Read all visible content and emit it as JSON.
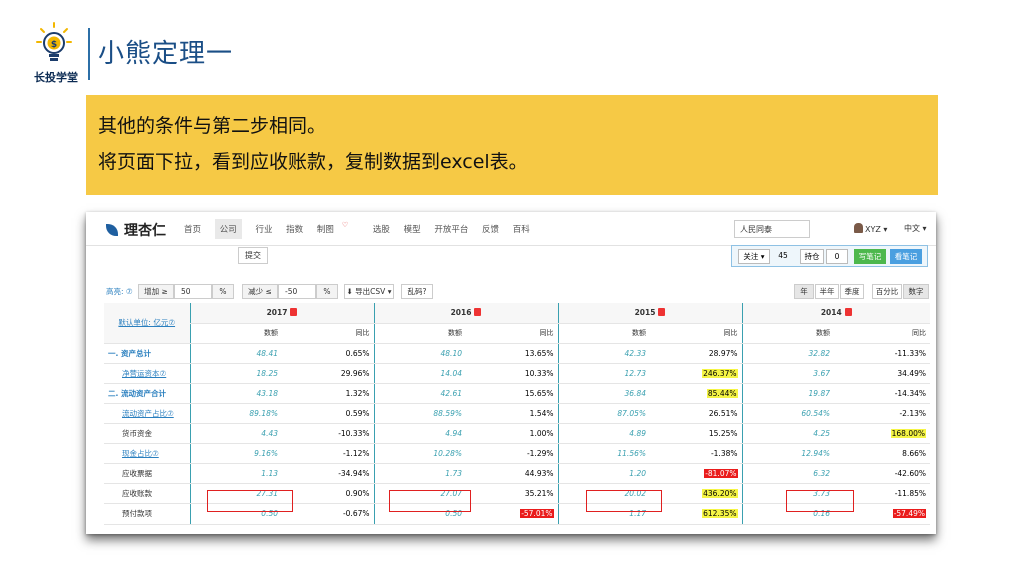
{
  "slide": {
    "logo_text": "长投学堂",
    "title": "小熊定理一",
    "lines": [
      "其他的条件与第二步相同。",
      "将页面下拉，看到应收账款，复制数据到excel表。"
    ]
  },
  "app": {
    "brand": "理杏仁",
    "nav": [
      "首页",
      "公司",
      "行业",
      "指数",
      "制图",
      "选股",
      "模型",
      "开放平台",
      "反馈",
      "百科"
    ],
    "search_value": "人民同泰",
    "user": "XYZ ▾",
    "lang": "中文 ▾",
    "submit": "提交",
    "follow_label": "关注 ▾",
    "follow_count": "45",
    "holding_label": "持仓",
    "holding_count": "0",
    "write_note": "写笔记",
    "view_note": "看笔记"
  },
  "filters": {
    "highlight": "高亮: ⑦",
    "increase": "增加 ≥",
    "increase_val": "50",
    "pct1": "%",
    "decrease": "减少 ≤",
    "decrease_val": "-50",
    "pct2": "%",
    "export": "⬇ 导出CSV ▾",
    "garbled": "乱码?",
    "periods": [
      "年",
      "半年",
      "季度"
    ],
    "modes": [
      "百分比",
      "数字"
    ]
  },
  "table": {
    "unit_label": "默认单位: 亿元⑦",
    "years": [
      "2017",
      "2016",
      "2015",
      "2014"
    ],
    "sub_headers": [
      "数额",
      "同比"
    ],
    "rows": [
      {
        "label": "一. 资产总计",
        "style": "main",
        "cells": [
          "48.41",
          "0.65%",
          "48.10",
          "13.65%",
          "42.33",
          "28.97%",
          "32.82",
          "-11.33%"
        ]
      },
      {
        "label": "净营运资本⑦",
        "style": "sub",
        "cells": [
          "18.25",
          "29.96%",
          "14.04",
          "10.33%",
          "12.73",
          "246.37%",
          "3.67",
          "34.49%"
        ]
      },
      {
        "label": "二. 流动资产合计",
        "style": "main",
        "cells": [
          "43.18",
          "1.32%",
          "42.61",
          "15.65%",
          "36.84",
          "85.44%",
          "19.87",
          "-14.34%"
        ]
      },
      {
        "label": "流动资产占比⑦",
        "style": "sub",
        "cells": [
          "89.18%",
          "0.59%",
          "88.59%",
          "1.54%",
          "87.05%",
          "26.51%",
          "60.54%",
          "-2.13%"
        ]
      },
      {
        "label": "货币资金",
        "style": "plain",
        "cells": [
          "4.43",
          "-10.33%",
          "4.94",
          "1.00%",
          "4.89",
          "15.25%",
          "4.25",
          "168.00%"
        ]
      },
      {
        "label": "现金占比⑦",
        "style": "sub",
        "cells": [
          "9.16%",
          "-1.12%",
          "10.28%",
          "-1.29%",
          "11.56%",
          "-1.38%",
          "12.94%",
          "8.66%"
        ]
      },
      {
        "label": "应收票据",
        "style": "plain",
        "cells": [
          "1.13",
          "-34.94%",
          "1.73",
          "44.93%",
          "1.20",
          "-81.07%",
          "6.32",
          "-42.60%"
        ]
      },
      {
        "label": "应收账款",
        "style": "plain",
        "cells": [
          "27.31",
          "0.90%",
          "27.07",
          "35.21%",
          "20.02",
          "436.20%",
          "3.73",
          "-11.85%"
        ]
      },
      {
        "label": "预付款项",
        "style": "plain",
        "cells": [
          "0.50",
          "-0.67%",
          "0.50",
          "-57.01%",
          "1.17",
          "612.35%",
          "0.16",
          "-57.49%"
        ]
      }
    ],
    "highlights": {
      "1.5": "y",
      "2.5": "y",
      "4.7": "y",
      "6.5": "r",
      "7.5": "y",
      "8.3": "r",
      "8.5": "y",
      "8.7": "r"
    }
  }
}
